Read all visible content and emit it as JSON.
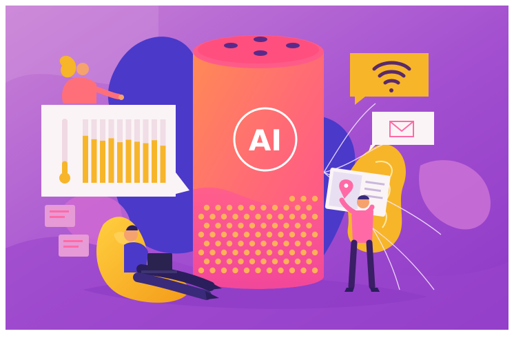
{
  "illustration": {
    "speaker_label": "AI",
    "bar_levels": [
      0.95,
      0.88,
      0.85,
      0.9,
      0.82,
      0.87,
      0.83,
      0.8,
      0.86,
      0.75
    ],
    "thermometer_level": 0.25
  },
  "colors": {
    "background": "#a24fcf",
    "background_light": "#c07ad8",
    "speaker_top": "#ff7a5c",
    "speaker_bottom": "#ff5f86",
    "accent_yellow": "#f7b52a",
    "blob_blue": "#4b39c9",
    "card_white": "#fbf4f6"
  },
  "icons": [
    "wifi-icon",
    "envelope-icon",
    "map-pin-icon",
    "thermometer-icon",
    "laptop-icon"
  ]
}
